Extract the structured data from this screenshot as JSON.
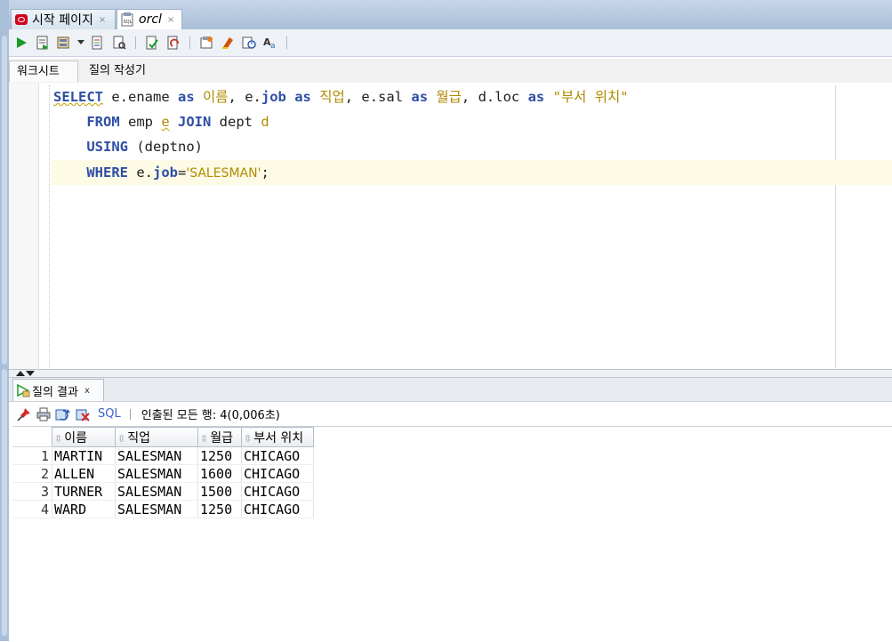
{
  "doc_tabs": [
    {
      "label": "시작 페이지",
      "close": "×"
    },
    {
      "label": "orcl",
      "close": "×"
    }
  ],
  "sub_tabs": [
    "워크시트",
    "질의 작성기"
  ],
  "editor": {
    "line1": {
      "kw_select": "SELECT",
      "e_ename": " e.ename ",
      "kw_as1": "as",
      "alias1": " 이름",
      "comma1": ", e.",
      "job1": "job",
      "sp1": " ",
      "kw_as2": "as",
      "alias2": " 직업",
      "comma2": ", e.sal ",
      "kw_as3": "as",
      "alias3": " 월급",
      "comma3": ", d.loc ",
      "kw_as4": "as",
      "str1": " \"부서 위치\""
    },
    "line2": {
      "kw_from": "FROM",
      "emp": " emp ",
      "e": "e",
      "sp": " ",
      "kw_join": "JOIN",
      "dept": " dept ",
      "d": "d"
    },
    "line3": {
      "kw_using": "USING",
      "rest": " (deptno)"
    },
    "line4": {
      "kw_where": "WHERE",
      "e": " e.",
      "job": "job",
      "eq": "=",
      "str": "'SALESMAN'",
      "semi": ";"
    }
  },
  "results": {
    "tab_label": "질의 결과",
    "tab_close": "x",
    "sql_label": "SQL",
    "status": "인출된 모든 행: 4(0,006초)",
    "columns": [
      "이름",
      "직업",
      "월급",
      "부서 위치"
    ],
    "rows": [
      {
        "n": "1",
        "c": [
          "MARTIN",
          "SALESMAN",
          "1250",
          "CHICAGO"
        ]
      },
      {
        "n": "2",
        "c": [
          "ALLEN",
          "SALESMAN",
          "1600",
          "CHICAGO"
        ]
      },
      {
        "n": "3",
        "c": [
          "TURNER",
          "SALESMAN",
          "1500",
          "CHICAGO"
        ]
      },
      {
        "n": "4",
        "c": [
          "WARD",
          "SALESMAN",
          "1250",
          "CHICAGO"
        ]
      }
    ]
  },
  "icons": {
    "toolbar": [
      "run-statement-icon",
      "run-script-icon",
      "autotrace-icon",
      "explain-plan-icon",
      "sql-tuning-icon",
      "commit-icon",
      "rollback-icon",
      "unshared-sql-icon",
      "clear-icon",
      "sql-history-icon",
      "format-case-icon"
    ],
    "results_toolbar": [
      "pin-icon",
      "print-icon",
      "refresh-icon",
      "cancel-icon"
    ]
  },
  "colors": {
    "keyword": "#2f4ea6",
    "string": "#b08a00",
    "current_line": "#fdfbe6",
    "tab_strip": "#a9bfd9"
  }
}
